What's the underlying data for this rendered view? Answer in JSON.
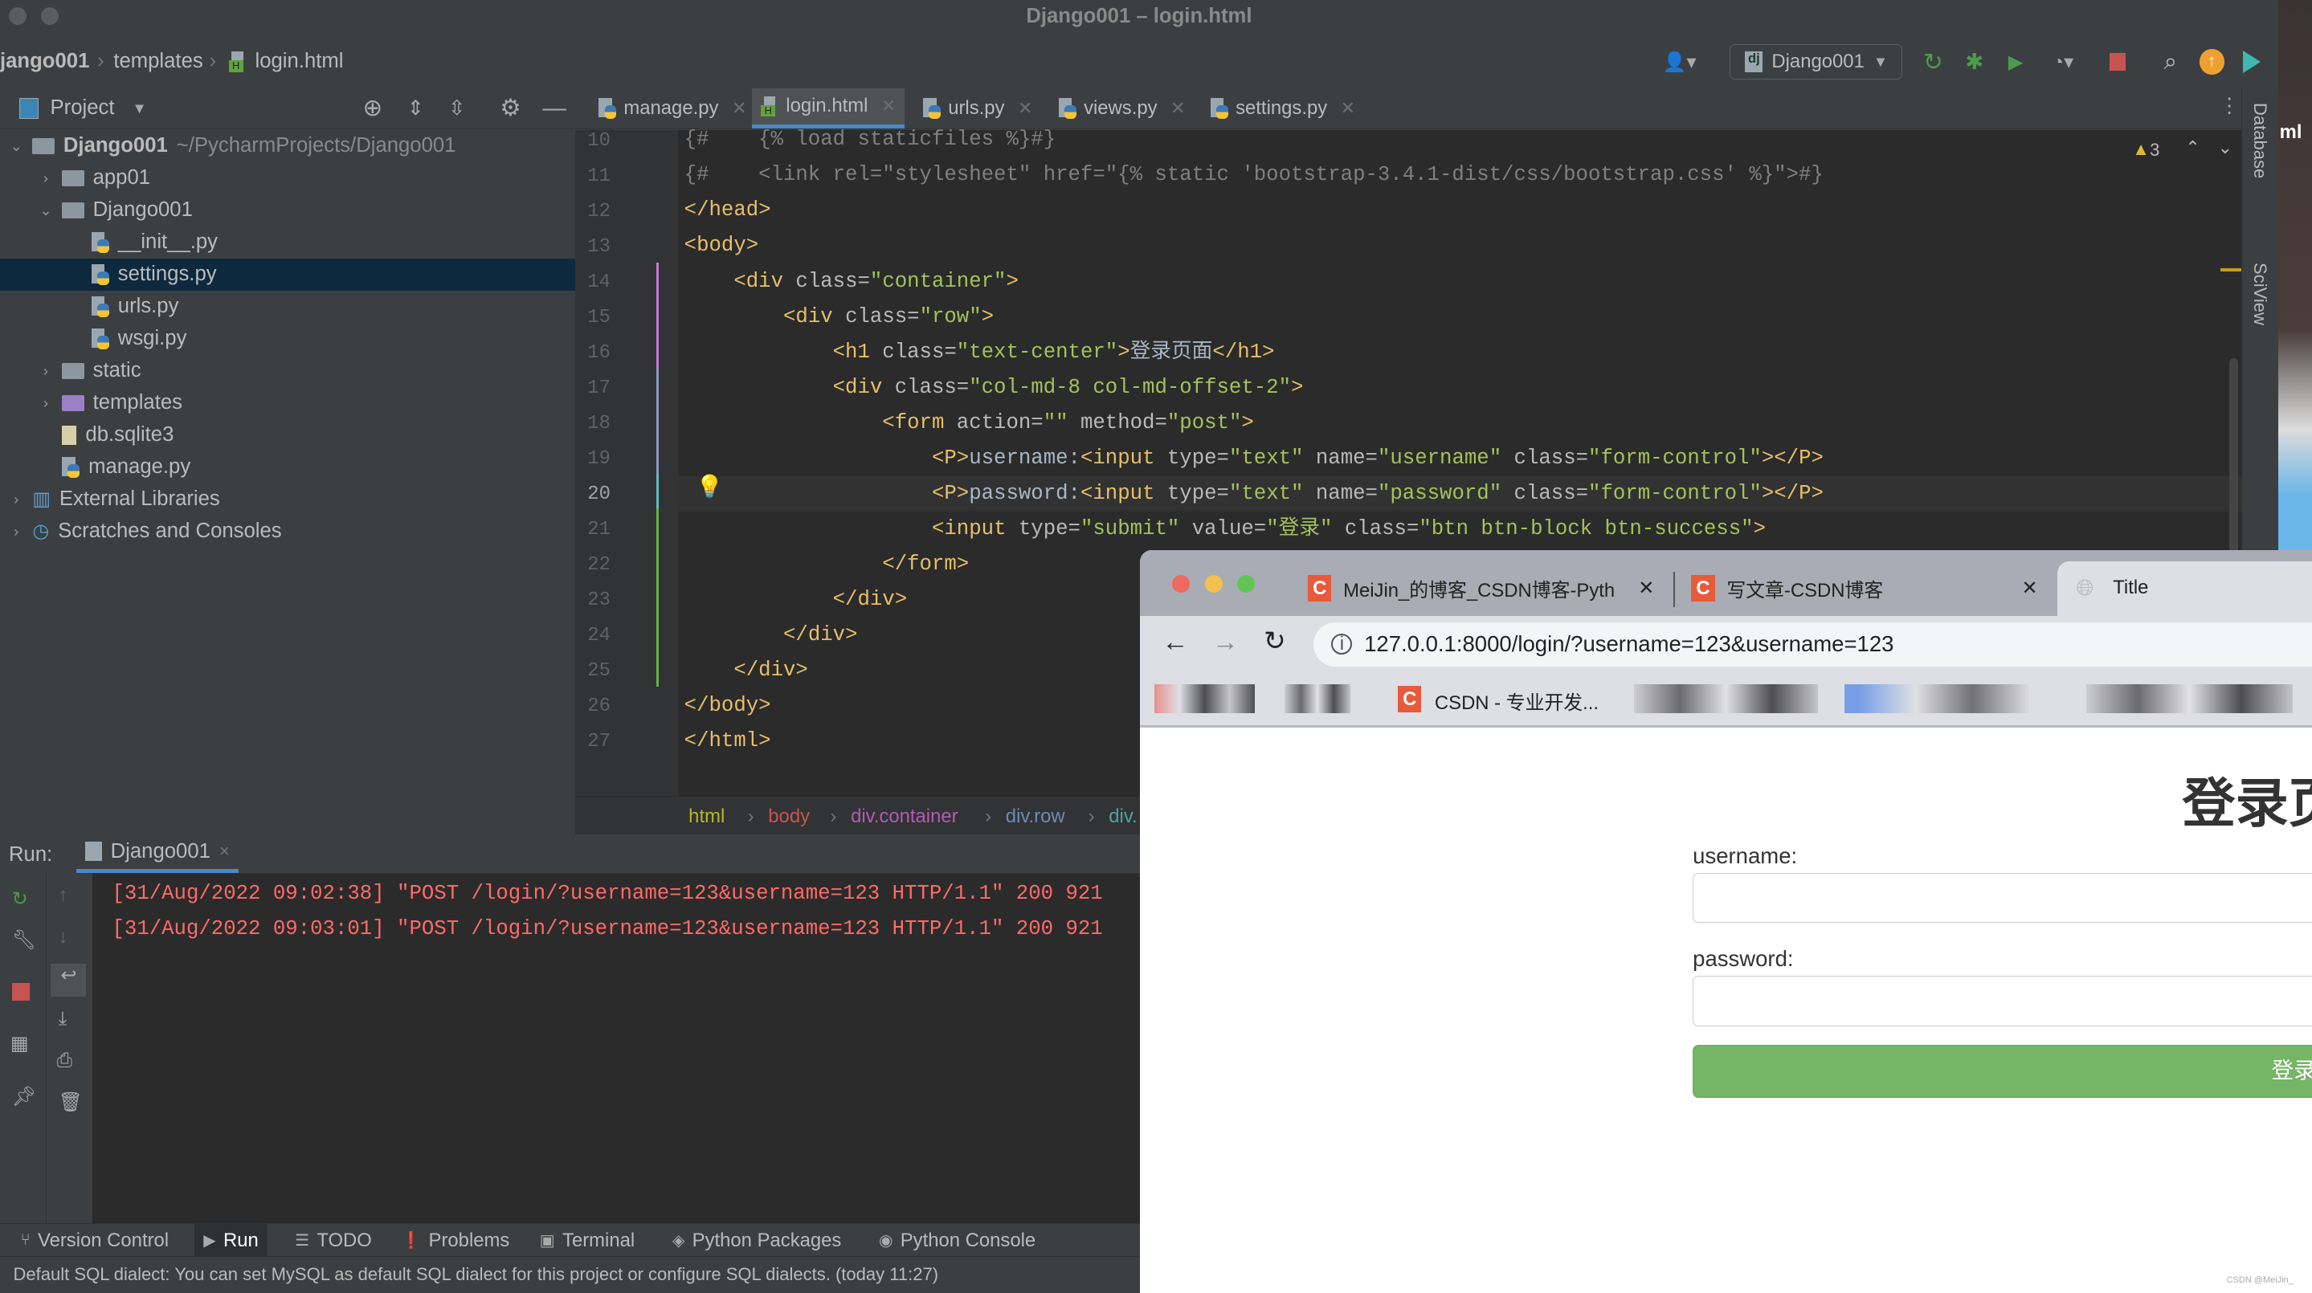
{
  "window": {
    "title": "Django001 – login.html"
  },
  "navbar": {
    "breadcrumb": [
      "jango001",
      "templates",
      "login.html"
    ],
    "run_config": "Django001"
  },
  "project_panel": {
    "title": "Project",
    "tree": [
      {
        "label": "Django001",
        "extra": "~/PycharmProjects/Django001",
        "level": 0,
        "type": "folder",
        "expanded": true
      },
      {
        "label": "app01",
        "level": 1,
        "type": "folder",
        "expanded": false
      },
      {
        "label": "Django001",
        "level": 1,
        "type": "folder",
        "expanded": true
      },
      {
        "label": "__init__.py",
        "level": 2,
        "type": "py"
      },
      {
        "label": "settings.py",
        "level": 2,
        "type": "py",
        "selected": true
      },
      {
        "label": "urls.py",
        "level": 2,
        "type": "py"
      },
      {
        "label": "wsgi.py",
        "level": 2,
        "type": "py"
      },
      {
        "label": "static",
        "level": 1,
        "type": "folder",
        "expanded": false
      },
      {
        "label": "templates",
        "level": 1,
        "type": "folder-purple",
        "expanded": false
      },
      {
        "label": "db.sqlite3",
        "level": 1,
        "type": "file"
      },
      {
        "label": "manage.py",
        "level": 1,
        "type": "py"
      },
      {
        "label": "External Libraries",
        "level": 0,
        "type": "lib",
        "expanded": false
      },
      {
        "label": "Scratches and Consoles",
        "level": 0,
        "type": "scratch",
        "expanded": false
      }
    ]
  },
  "editor_tabs": [
    {
      "label": "manage.py",
      "icon": "py"
    },
    {
      "label": "login.html",
      "icon": "html",
      "active": true
    },
    {
      "label": "urls.py",
      "icon": "py"
    },
    {
      "label": "views.py",
      "icon": "py"
    },
    {
      "label": "settings.py",
      "icon": "py"
    }
  ],
  "editor": {
    "warning_count": "3",
    "current_line": 20,
    "lines": [
      {
        "n": "10",
        "tokens": [
          {
            "t": "{#    {% load staticfiles %}#}",
            "k": "comment"
          }
        ]
      },
      {
        "n": "11",
        "tokens": [
          {
            "t": "{#    <link rel=\"stylesheet\" href=\"{% static 'bootstrap-3.4.1-dist/css/bootstrap.css' %}\">#}",
            "k": "comment"
          }
        ]
      },
      {
        "n": "12",
        "tokens": [
          {
            "t": "</head>",
            "k": "tag"
          }
        ]
      },
      {
        "n": "13",
        "tokens": [
          {
            "t": "<body>",
            "k": "tag"
          }
        ]
      },
      {
        "n": "14",
        "tokens": [
          {
            "t": "    ",
            "k": "text"
          },
          {
            "t": "<div",
            "k": "tag"
          },
          {
            "t": " class=",
            "k": "attr"
          },
          {
            "t": "\"container\"",
            "k": "str"
          },
          {
            "t": ">",
            "k": "tag"
          }
        ]
      },
      {
        "n": "15",
        "tokens": [
          {
            "t": "        ",
            "k": "text"
          },
          {
            "t": "<div",
            "k": "tag"
          },
          {
            "t": " class=",
            "k": "attr"
          },
          {
            "t": "\"row\"",
            "k": "str"
          },
          {
            "t": ">",
            "k": "tag"
          }
        ]
      },
      {
        "n": "16",
        "tokens": [
          {
            "t": "            ",
            "k": "text"
          },
          {
            "t": "<h1",
            "k": "tag"
          },
          {
            "t": " class=",
            "k": "attr"
          },
          {
            "t": "\"text-center\"",
            "k": "str"
          },
          {
            "t": ">",
            "k": "tag"
          },
          {
            "t": "登录页面",
            "k": "text"
          },
          {
            "t": "</h1>",
            "k": "tag"
          }
        ]
      },
      {
        "n": "17",
        "tokens": [
          {
            "t": "            ",
            "k": "text"
          },
          {
            "t": "<div",
            "k": "tag"
          },
          {
            "t": " class=",
            "k": "attr"
          },
          {
            "t": "\"col-md-8 col-md-offset-2\"",
            "k": "str"
          },
          {
            "t": ">",
            "k": "tag"
          }
        ]
      },
      {
        "n": "18",
        "tokens": [
          {
            "t": "                ",
            "k": "text"
          },
          {
            "t": "<form",
            "k": "tag"
          },
          {
            "t": " action=",
            "k": "attr"
          },
          {
            "t": "\"\"",
            "k": "str"
          },
          {
            "t": " method=",
            "k": "attr"
          },
          {
            "t": "\"post\"",
            "k": "str"
          },
          {
            "t": ">",
            "k": "tag"
          }
        ]
      },
      {
        "n": "19",
        "tokens": [
          {
            "t": "                    ",
            "k": "text"
          },
          {
            "t": "<P>",
            "k": "tag"
          },
          {
            "t": "username:",
            "k": "text"
          },
          {
            "t": "<input",
            "k": "tag"
          },
          {
            "t": " type=",
            "k": "attr"
          },
          {
            "t": "\"text\"",
            "k": "str"
          },
          {
            "t": " name=",
            "k": "attr"
          },
          {
            "t": "\"username\"",
            "k": "str"
          },
          {
            "t": " class=",
            "k": "attr"
          },
          {
            "t": "\"form-control\"",
            "k": "str"
          },
          {
            "t": "></P>",
            "k": "tag"
          }
        ]
      },
      {
        "n": "20",
        "tokens": [
          {
            "t": "                    ",
            "k": "text"
          },
          {
            "t": "<P>",
            "k": "tag"
          },
          {
            "t": "password:",
            "k": "text"
          },
          {
            "t": "<input",
            "k": "tag"
          },
          {
            "t": " type=",
            "k": "attr"
          },
          {
            "t": "\"text\"",
            "k": "str"
          },
          {
            "t": " name=",
            "k": "attr"
          },
          {
            "t": "\"password\"",
            "k": "str"
          },
          {
            "t": " class=",
            "k": "attr"
          },
          {
            "t": "\"form-control\"",
            "k": "str"
          },
          {
            "t": "></P>",
            "k": "tag"
          }
        ]
      },
      {
        "n": "21",
        "tokens": [
          {
            "t": "                    ",
            "k": "text"
          },
          {
            "t": "<input",
            "k": "tag"
          },
          {
            "t": " type=",
            "k": "attr"
          },
          {
            "t": "\"submit\"",
            "k": "str"
          },
          {
            "t": " value=",
            "k": "attr"
          },
          {
            "t": "\"登录\"",
            "k": "str"
          },
          {
            "t": " class=",
            "k": "attr"
          },
          {
            "t": "\"btn btn-block btn-success\"",
            "k": "str"
          },
          {
            "t": ">",
            "k": "tag"
          }
        ]
      },
      {
        "n": "22",
        "tokens": [
          {
            "t": "                ",
            "k": "text"
          },
          {
            "t": "</form>",
            "k": "tag"
          }
        ]
      },
      {
        "n": "23",
        "tokens": [
          {
            "t": "            ",
            "k": "text"
          },
          {
            "t": "</div>",
            "k": "tag"
          }
        ]
      },
      {
        "n": "24",
        "tokens": [
          {
            "t": "        ",
            "k": "text"
          },
          {
            "t": "</div>",
            "k": "tag"
          }
        ]
      },
      {
        "n": "25",
        "tokens": [
          {
            "t": "    ",
            "k": "text"
          },
          {
            "t": "</div>",
            "k": "tag"
          }
        ]
      },
      {
        "n": "26",
        "tokens": [
          {
            "t": "</body>",
            "k": "tag"
          }
        ]
      },
      {
        "n": "27",
        "tokens": [
          {
            "t": "</html>",
            "k": "tag"
          }
        ]
      }
    ],
    "breadcrumb": [
      {
        "label": "html",
        "color": "#bbb529"
      },
      {
        "label": "body",
        "color": "#c75450"
      },
      {
        "label": "div.container",
        "color": "#b35bb5"
      },
      {
        "label": "div.row",
        "color": "#6d8ab5"
      },
      {
        "label": "div.",
        "color": "#4fa3a0"
      }
    ]
  },
  "run_panel": {
    "label": "Run:",
    "tab": "Django001",
    "log": [
      "[31/Aug/2022 09:02:38] \"POST /login/?username=123&username=123 HTTP/1.1\" 200 921",
      "[31/Aug/2022 09:03:01] \"POST /login/?username=123&username=123 HTTP/1.1\" 200 921"
    ]
  },
  "bottom_tools": [
    "Version Control",
    "Run",
    "TODO",
    "Problems",
    "Terminal",
    "Python Packages",
    "Python Console"
  ],
  "status_bar": "Default SQL dialect: You can set MySQL as default SQL dialect for this project or configure SQL dialects. (today 11:27)",
  "right_strip": [
    "Database",
    "SciView"
  ],
  "desktop_fragment": "ml",
  "browser": {
    "tabs": [
      {
        "label": "MeiJin_的博客_CSDN博客-Pyth"
      },
      {
        "label": "写文章-CSDN博客"
      },
      {
        "label": "Title",
        "active": true
      }
    ],
    "url": "127.0.0.1:8000/login/?username=123&username=123",
    "bookmark": "CSDN - 专业开发...",
    "page": {
      "heading": "登录页面",
      "username_label": "username:",
      "password_label": "password:",
      "submit_label": "登录",
      "submit_color": "#74b566"
    },
    "watermark": "CSDN @MeiJin_"
  },
  "colors": {
    "accent": "#4a88c7",
    "log_error": "#ff6b68",
    "selection": "#0d293e"
  }
}
